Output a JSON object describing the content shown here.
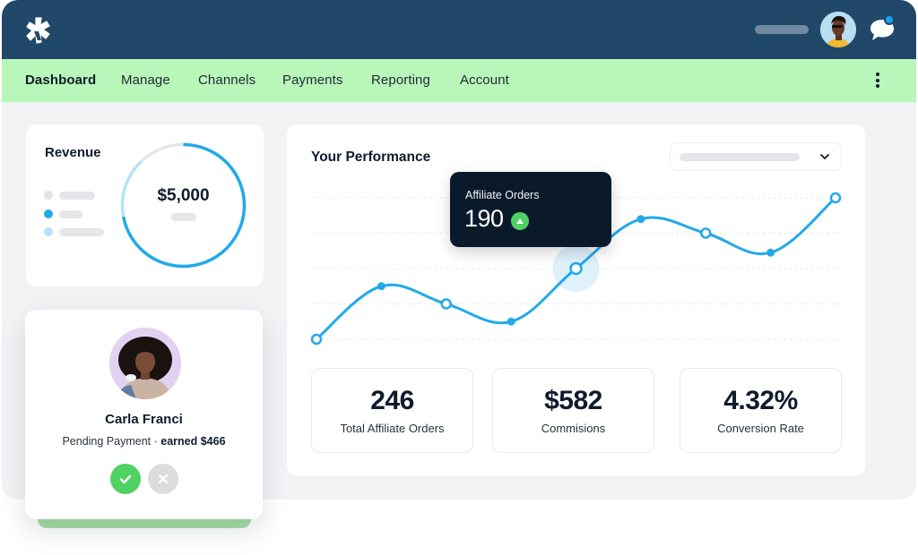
{
  "colors": {
    "header_bg": "#214868",
    "nav_bg": "#b8f6b9",
    "accent_blue": "#22a9ea",
    "light_blue": "#b7e3f7",
    "success_green": "#4fd163",
    "tooltip_bg": "#0b1a2a",
    "text_dark": "#0f1b2d"
  },
  "header": {
    "logo_icon": "asterisk-logo-icon",
    "user_avatar": "user-avatar",
    "chat_icon": "chat-bubble-icon",
    "has_notification": true
  },
  "nav": {
    "items": [
      {
        "label": "Dashboard",
        "active": true
      },
      {
        "label": "Manage",
        "active": false
      },
      {
        "label": "Channels",
        "active": false
      },
      {
        "label": "Payments",
        "active": false
      },
      {
        "label": "Reporting",
        "active": false
      },
      {
        "label": "Account",
        "active": false
      }
    ],
    "more_icon": "kebab-menu-icon"
  },
  "revenue": {
    "title": "Revenue",
    "value": "$5,000",
    "progress_fraction": 0.72,
    "legend_colors": [
      "#e3e3e6",
      "#22a9ea",
      "#b7e3f7"
    ]
  },
  "profile": {
    "name": "Carla Franci",
    "status": "Pending Payment",
    "separator": " · ",
    "earned": "earned $466",
    "approve_icon": "check-icon",
    "reject_icon": "close-icon"
  },
  "performance": {
    "title": "Your Performance",
    "select_icon": "chevron-down-icon",
    "tooltip": {
      "label": "Affiliate Orders",
      "value": "190",
      "trend_icon": "triangle-up-icon"
    },
    "stats": [
      {
        "value": "246",
        "label": "Total Affiliate Orders"
      },
      {
        "value": "$582",
        "label": "Commisions"
      },
      {
        "value": "4.32%",
        "label": "Conversion Rate"
      }
    ]
  },
  "chart_data": {
    "type": "line",
    "title": "Your Performance",
    "xlabel": "",
    "ylabel": "",
    "x": [
      1,
      2,
      3,
      4,
      5,
      6,
      7,
      8,
      9
    ],
    "series": [
      {
        "name": "Affiliate Orders",
        "values": [
          150,
          180,
          170,
          160,
          190,
          218,
          210,
          199,
          230
        ]
      }
    ],
    "point_style": [
      "hollow",
      "filled",
      "hollow",
      "filled",
      "hollow",
      "filled",
      "hollow",
      "filled",
      "hollow"
    ],
    "highlighted_index": 4,
    "ylim": [
      150,
      230
    ],
    "gridlines": [
      150,
      170,
      190,
      210,
      230
    ],
    "grid": true,
    "legend": "none"
  }
}
